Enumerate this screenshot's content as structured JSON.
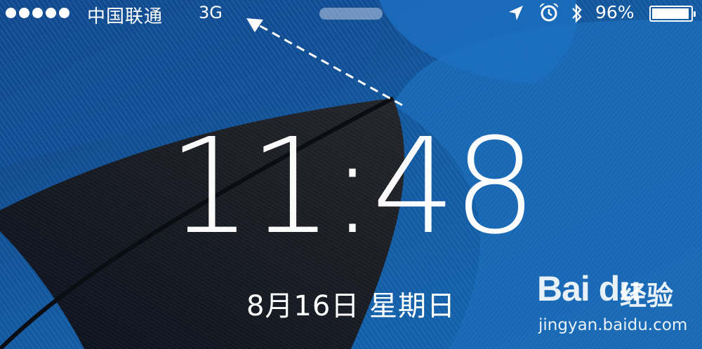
{
  "status_bar": {
    "signal_dots": 5,
    "carrier": "中国联通",
    "network": "3G",
    "battery_percent": "96%",
    "battery_level": 0.96,
    "icons": [
      "location-arrow-icon",
      "alarm-clock-icon",
      "bluetooth-icon",
      "battery-icon"
    ]
  },
  "lock_screen": {
    "time": "11:48",
    "date": "8月16日  星期日"
  },
  "watermark": {
    "logo": "Bai du",
    "brand_cn": "经验",
    "url": "jingyan.baidu.com"
  }
}
